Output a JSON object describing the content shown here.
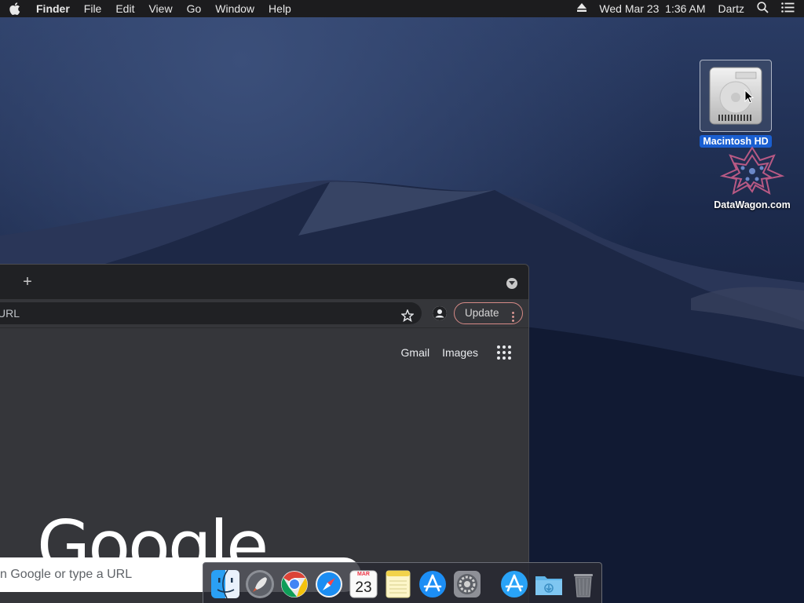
{
  "menubar": {
    "app_name": "Finder",
    "menus": [
      "File",
      "Edit",
      "View",
      "Go",
      "Window",
      "Help"
    ],
    "datetime": "Wed Mar 23  1:36 AM",
    "user": "Dartz"
  },
  "desktop": {
    "icons": [
      {
        "label": "Macintosh HD",
        "icon": "hard-drive-icon",
        "selected": true
      },
      {
        "label": "DataWagon.com",
        "icon": "datawagon-logo-icon",
        "selected": false
      }
    ]
  },
  "browser": {
    "omnibox_text": "URL",
    "update_label": "Update",
    "links": {
      "gmail": "Gmail",
      "images": "Images"
    },
    "logo_text": "Google",
    "search_placeholder": "n Google or type a URL"
  },
  "dock": {
    "items": [
      "finder-icon",
      "launchpad-icon",
      "chrome-icon",
      "safari-icon",
      "calendar-icon",
      "notes-icon",
      "app-store-icon",
      "system-preferences-icon",
      "app-store-download-icon",
      "downloads-folder-icon",
      "trash-icon"
    ],
    "calendar": {
      "month": "MAR",
      "day": "23"
    }
  },
  "colors": {
    "menubar_bg": "#1c1c1e",
    "selection_blue": "#1a5fd1",
    "browser_bg": "#35363a",
    "update_border": "#d68a86"
  }
}
